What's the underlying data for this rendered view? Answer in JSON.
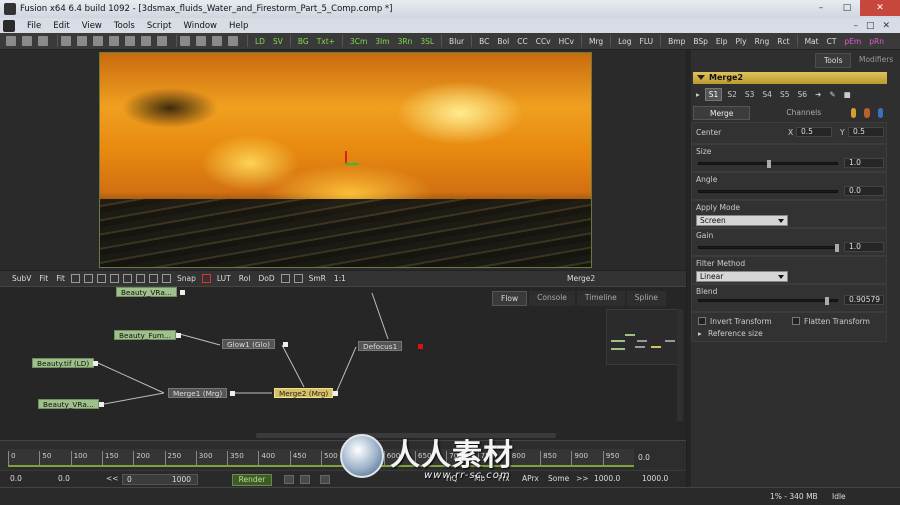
{
  "window": {
    "title": "Fusion x64 6.4 build 1092 - [3dsmax_fluids_Water_and_Firestorm_Part_5_Comp.comp *]",
    "min": "–",
    "max": "□",
    "close": "✕"
  },
  "menu": {
    "items": [
      "File",
      "Edit",
      "View",
      "Tools",
      "Script",
      "Window",
      "Help"
    ],
    "right": [
      "–",
      "□",
      "✕"
    ]
  },
  "toolbar": {
    "groups": [
      [
        "LD",
        "SV"
      ],
      [
        "BG",
        "Txt+"
      ],
      [
        "3Cm",
        "3Im",
        "3Rn",
        "3SL"
      ],
      [
        "Blur"
      ],
      [
        "BC",
        "Bol",
        "CC",
        "CCv",
        "HCv"
      ],
      [
        "Mrg"
      ],
      [
        "Log",
        "FLU"
      ],
      [
        "Bmp",
        "BSp",
        "Elp",
        "Ply",
        "Rng",
        "Rct"
      ],
      [
        "Mat",
        "CT",
        "pEm",
        "pRn"
      ]
    ],
    "green_labels": [
      "LD",
      "SV",
      "BG",
      "Txt+",
      "3Cm",
      "3Im",
      "3Rn",
      "3SL",
      "pEm",
      "pRn"
    ]
  },
  "viewer_bar": {
    "items": [
      "SubV",
      "Fit",
      "Fit",
      "Snap",
      "LUT",
      "RoI",
      "DoD",
      "SmR",
      "1:1"
    ],
    "view_label": "Merge2"
  },
  "flow": {
    "tabs": [
      "Flow",
      "Console",
      "Timeline",
      "Spline"
    ],
    "active_tab": "Flow",
    "nodes": {
      "beauty_top": "Beauty_VRa...",
      "beauty_fum": "Beauty_Fum...",
      "beauty_tif": "Beauty.tif (LD)",
      "beauty_vra": "Beauty_VRa...",
      "glow1": "Glow1 (Glo)",
      "merge1": "Merge1 (Mrg)",
      "merge2": "Merge2 (Mrg)",
      "defocus1": "Defocus1"
    }
  },
  "timeline": {
    "ticks": [
      "0",
      "50",
      "100",
      "150",
      "200",
      "250",
      "300",
      "350",
      "400",
      "450",
      "500",
      "550",
      "600",
      "650",
      "700",
      "750",
      "800",
      "850",
      "900",
      "950"
    ],
    "end_value": "0.0"
  },
  "transport": {
    "start": "0.0",
    "current": "0.0",
    "range_start": "0",
    "range_end": "1000",
    "render": "Render",
    "hq": "HQ",
    "mb": "Mb",
    "prx": "Prx",
    "aprx": "APrx",
    "some": "Some",
    "end1": "1000.0",
    "end2": "1000.0"
  },
  "status": {
    "memory": "1% - 340 MB",
    "state": "Idle"
  },
  "panel": {
    "tabs": [
      "Tools",
      "Modifiers"
    ],
    "active_tab": "Tools",
    "tool_name": "Merge2",
    "selectors": [
      "S1",
      "S2",
      "S3",
      "S4",
      "S5",
      "S6"
    ],
    "sub_tabs": [
      "Merge",
      "Channels"
    ],
    "center_label": "Center",
    "center_x_label": "X",
    "center_x": "0.5",
    "center_y_label": "Y",
    "center_y": "0.5",
    "size_label": "Size",
    "size": "1.0",
    "angle_label": "Angle",
    "angle": "0.0",
    "apply_mode_label": "Apply Mode",
    "apply_mode": "Screen",
    "gain_label": "Gain",
    "gain": "1.0",
    "filter_label": "Filter Method",
    "filter": "Linear",
    "blend_label": "Blend",
    "blend": "0.90579",
    "invert_label": "Invert Transform",
    "flatten_label": "Flatten Transform",
    "ref_size_label": "Reference size"
  },
  "watermark": {
    "text": "人人素材",
    "url": "www.rr-sc.com"
  },
  "colors": {
    "accent_green": "#7ea33a",
    "selected_node": "#d7c166",
    "loader_node": "#9fc08a",
    "panel_header": "#e0c35a"
  }
}
